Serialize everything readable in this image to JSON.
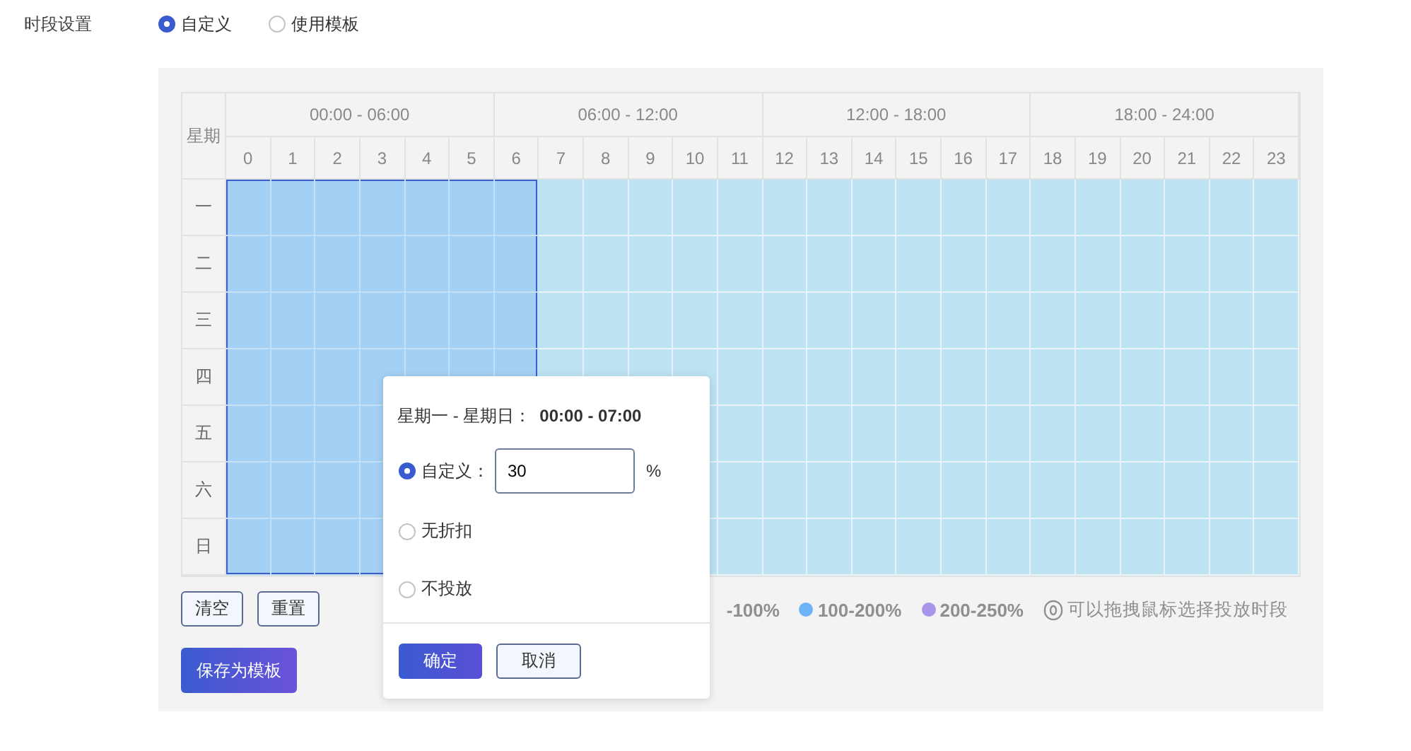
{
  "period_setting": {
    "label": "时段设置",
    "options": [
      {
        "label": "自定义",
        "selected": true
      },
      {
        "label": "使用模板",
        "selected": false
      }
    ]
  },
  "schedule": {
    "corner": "星期",
    "groups": [
      "00:00 - 06:00",
      "06:00 - 12:00",
      "12:00 - 18:00",
      "18:00 - 24:00"
    ],
    "hours": [
      {
        "label": "0",
        "selected": true
      },
      {
        "label": "1",
        "selected": true
      },
      {
        "label": "2",
        "selected": true
      },
      {
        "label": "3",
        "selected": true
      },
      {
        "label": "4",
        "selected": true
      },
      {
        "label": "5",
        "selected": true
      },
      {
        "label": "6",
        "selected": true
      },
      {
        "label": "7",
        "selected": false
      },
      {
        "label": "8",
        "selected": false
      },
      {
        "label": "9",
        "selected": false
      },
      {
        "label": "10",
        "selected": false
      },
      {
        "label": "11",
        "selected": false
      },
      {
        "label": "12",
        "selected": false
      },
      {
        "label": "13",
        "selected": false
      },
      {
        "label": "14",
        "selected": false
      },
      {
        "label": "15",
        "selected": false
      },
      {
        "label": "16",
        "selected": false
      },
      {
        "label": "17",
        "selected": false
      },
      {
        "label": "18",
        "selected": false
      },
      {
        "label": "19",
        "selected": false
      },
      {
        "label": "20",
        "selected": false
      },
      {
        "label": "21",
        "selected": false
      },
      {
        "label": "22",
        "selected": false
      },
      {
        "label": "23",
        "selected": false
      }
    ],
    "days": [
      {
        "label": "一",
        "selected": true
      },
      {
        "label": "二",
        "selected": true
      },
      {
        "label": "三",
        "selected": true
      },
      {
        "label": "四",
        "selected": true
      },
      {
        "label": "五",
        "selected": true
      },
      {
        "label": "六",
        "selected": true
      },
      {
        "label": "日",
        "selected": true
      }
    ]
  },
  "actions": [
    "清空",
    "重置"
  ],
  "save_template": "保存为模板",
  "legend": [
    {
      "label": "-100%"
    },
    {
      "label": "100-200%",
      "color": "#6db3f7"
    },
    {
      "label": "200-250%",
      "color": "#a895ea"
    }
  ],
  "hint": "可以拖拽鼠标选择投放时段",
  "popup": {
    "title": "星期一 - 星期日：",
    "range": "00:00 - 07:00",
    "options": [
      {
        "kind": "custom",
        "label": "自定义：",
        "value": "30",
        "unit": "%",
        "selected": true
      },
      {
        "kind": "plain",
        "label": "无折扣",
        "selected": false
      },
      {
        "kind": "plain",
        "label": "不投放",
        "selected": false
      }
    ],
    "confirm": "确定",
    "cancel": "取消"
  }
}
